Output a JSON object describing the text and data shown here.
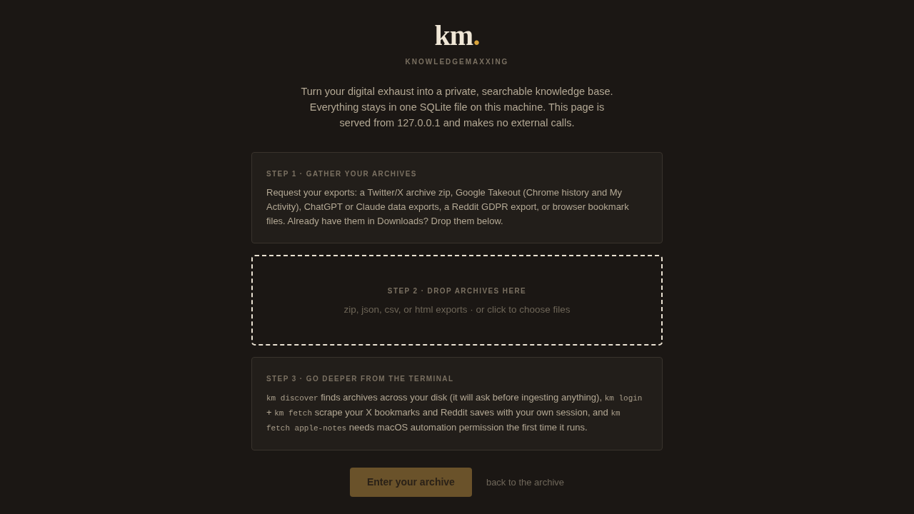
{
  "logo": {
    "text": "km",
    "accent": "."
  },
  "tagline": "KNOWLEDGEMAXXING",
  "intro": "Turn your digital exhaust into a private, searchable knowledge base. Everything stays in one SQLite file on this machine. This page is served from 127.0.0.1 and makes no external calls.",
  "steps": [
    {
      "kind": "card",
      "label": "STEP 1 · GATHER YOUR ARCHIVES",
      "body": [
        {
          "kind": "text",
          "text": "Request your exports: a Twitter/X archive zip, Google Takeout (Chrome history and My Activity), ChatGPT or Claude data exports, a Reddit GDPR export, or browser bookmark files. Already have them in Downloads? Drop them below."
        }
      ]
    },
    {
      "kind": "dropzone",
      "label": "STEP 2 · DROP ARCHIVES HERE",
      "hint": "zip, json, csv, or html exports · or click to choose files"
    },
    {
      "kind": "card",
      "label": "STEP 3 · GO DEEPER FROM THE TERMINAL",
      "body": [
        {
          "kind": "code",
          "text": "km discover"
        },
        {
          "kind": "text",
          "text": " finds archives across your disk (it will ask before ingesting anything), "
        },
        {
          "kind": "code",
          "text": "km login"
        },
        {
          "kind": "text",
          "text": " + "
        },
        {
          "kind": "code",
          "text": "km fetch"
        },
        {
          "kind": "text",
          "text": " scrape your X bookmarks and Reddit saves with your own session, and "
        },
        {
          "kind": "code",
          "text": "km fetch apple-notes"
        },
        {
          "kind": "text",
          "text": " needs macOS automation permission the first time it runs."
        }
      ]
    }
  ],
  "actions": [
    {
      "kind": "primary",
      "label": "Enter your archive",
      "disabled": true
    },
    {
      "kind": "link",
      "label": "back to the archive"
    }
  ]
}
